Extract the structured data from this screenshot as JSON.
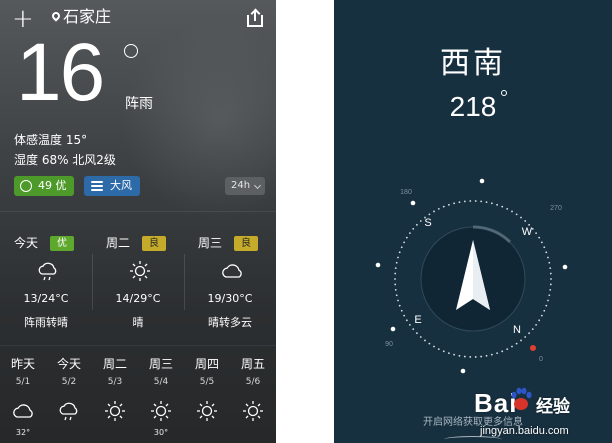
{
  "weather": {
    "city": "石家庄",
    "temperature": "16",
    "condition": "阵雨",
    "feels_like": "体感温度 15°",
    "humidity_wind": "湿度 68% 北风2级",
    "aqi_badge": "49 优",
    "wind_badge": "大风",
    "interval_selector": "24h",
    "colors": {
      "aqi_green": "#4d9a2a",
      "wind_blue": "#2d6aa8",
      "quality_fair": "#c4ab2a"
    },
    "daily": [
      {
        "day": "今天",
        "quality": "优",
        "icon": "cloud-rain-icon",
        "range": "13/24°C",
        "desc": "阵雨转晴"
      },
      {
        "day": "周二",
        "quality": "良",
        "icon": "sun-icon",
        "range": "14/29°C",
        "desc": "晴"
      },
      {
        "day": "周三",
        "quality": "良",
        "icon": "cloud-icon",
        "range": "19/30°C",
        "desc": "晴转多云"
      }
    ],
    "hourly": [
      {
        "label": "昨天",
        "date": "5/1",
        "icon": "cloud-icon",
        "temp": "32°"
      },
      {
        "label": "今天",
        "date": "5/2",
        "icon": "cloud-rain-icon",
        "temp": ""
      },
      {
        "label": "周二",
        "date": "5/3",
        "icon": "sun-icon",
        "temp": ""
      },
      {
        "label": "周三",
        "date": "5/4",
        "icon": "sun-icon",
        "temp": "30°"
      },
      {
        "label": "周四",
        "date": "5/5",
        "icon": "sun-icon",
        "temp": ""
      },
      {
        "label": "周五",
        "date": "5/6",
        "icon": "sun-icon",
        "temp": ""
      }
    ]
  },
  "compass": {
    "direction": "西南",
    "heading": "218",
    "cardinals": {
      "S": "S",
      "W": "W",
      "E": "E",
      "N": "N"
    },
    "scale_labels": {
      "s180": "180",
      "s270": "270",
      "s90": "90",
      "s0": "0"
    },
    "rotation_deg": 218,
    "hint": "开启网络获取更多信息",
    "colors": {
      "background": "#173040",
      "north_marker": "#e0412f"
    }
  },
  "watermark": {
    "brand": "Bai",
    "brand_cn": "经验",
    "url": "jingyan.baidu.com"
  }
}
